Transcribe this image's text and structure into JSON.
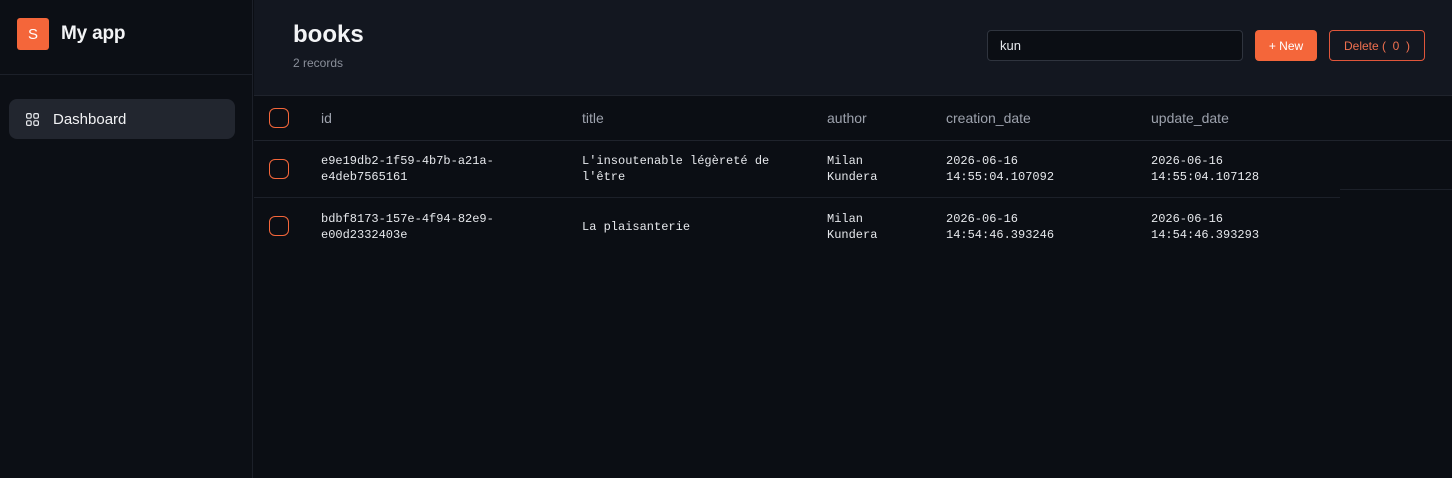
{
  "sidebar": {
    "logo_letter": "S",
    "app_name": "My app",
    "items": [
      {
        "label": "Dashboard",
        "icon": "grid-icon"
      }
    ]
  },
  "header": {
    "title": "books",
    "subtitle": "2 records",
    "search_value": "kun",
    "new_button": "+ New",
    "delete_button": "Delete (  0  )"
  },
  "table": {
    "columns": [
      "id",
      "title",
      "author",
      "creation_date",
      "update_date"
    ],
    "rows": [
      {
        "id": [
          "e9e19db2-1f59-4b7b-a21a-",
          "e4deb7565161"
        ],
        "title": [
          "L'insoutenable légèreté de",
          "l'être"
        ],
        "author": [
          "Milan",
          "Kundera"
        ],
        "creation_date": [
          "2026-06-16",
          "14:55:04.107092"
        ],
        "update_date": [
          "2026-06-16",
          "14:55:04.107128"
        ]
      },
      {
        "id": [
          "bdbf8173-157e-4f94-82e9-",
          "e00d2332403e"
        ],
        "title": [
          "La plaisanterie"
        ],
        "author": [
          "Milan",
          "Kundera"
        ],
        "creation_date": [
          "2026-06-16",
          "14:54:46.393246"
        ],
        "update_date": [
          "2026-06-16",
          "14:54:46.393293"
        ]
      }
    ]
  },
  "colors": {
    "accent": "#f4663a",
    "background": "#0b0e14",
    "header_bg": "#131720",
    "danger": "#e0563b"
  }
}
